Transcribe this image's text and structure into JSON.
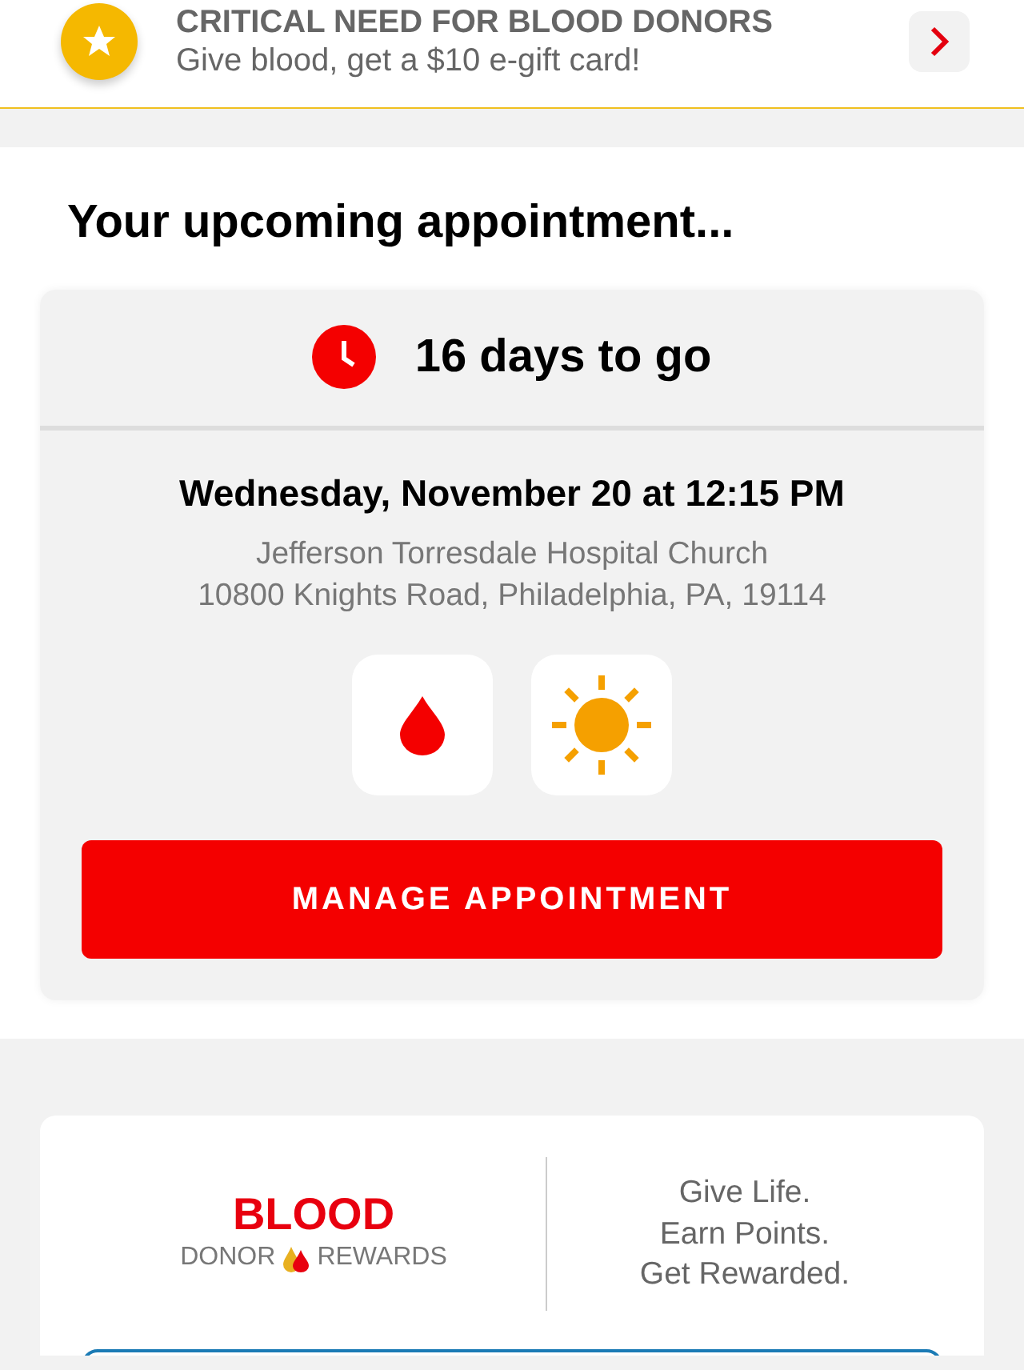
{
  "banner": {
    "title": "CRITICAL NEED FOR BLOOD DONORS",
    "subtitle": "Give blood, get a $10 e-gift card!"
  },
  "appointment": {
    "heading": "Your upcoming appointment...",
    "countdown": "16 days to go",
    "datetime": "Wednesday, November 20 at 12:15 PM",
    "location": "Jefferson Torresdale Hospital Church",
    "address": "10800 Knights Road, Philadelphia, PA, 19114",
    "tiles": [
      {
        "kind": "drop"
      },
      {
        "kind": "sun"
      }
    ],
    "button": "MANAGE APPOINTMENT"
  },
  "rewards": {
    "logo_main": "BLOOD",
    "logo_left": "DONOR",
    "logo_right": "REWARDS",
    "tagline": [
      "Give Life.",
      "Earn Points.",
      "Get Rewarded."
    ]
  }
}
